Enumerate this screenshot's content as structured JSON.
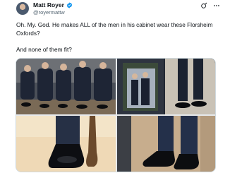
{
  "author": {
    "name": "Matt Royer",
    "handle": "@royermattw",
    "verified": true
  },
  "post": {
    "line1": "Oh. My. God. He makes ALL of the men in his cabinet wear these Florsheim Oxfords?",
    "line2": "And none of them fit?"
  },
  "icons": [
    "avatar",
    "verified-badge-icon",
    "grok-icon",
    "more-icon"
  ],
  "media": {
    "images": [
      "cabinet-men-seated-row",
      "white-house-portrait-and-shoes",
      "shoe-closeup-next-to-chair",
      "shoes-on-stone-floor"
    ]
  },
  "colors": {
    "text": "#0f1419",
    "secondary": "#536471",
    "verified": "#1d9bf0",
    "border": "#cfd9de"
  }
}
